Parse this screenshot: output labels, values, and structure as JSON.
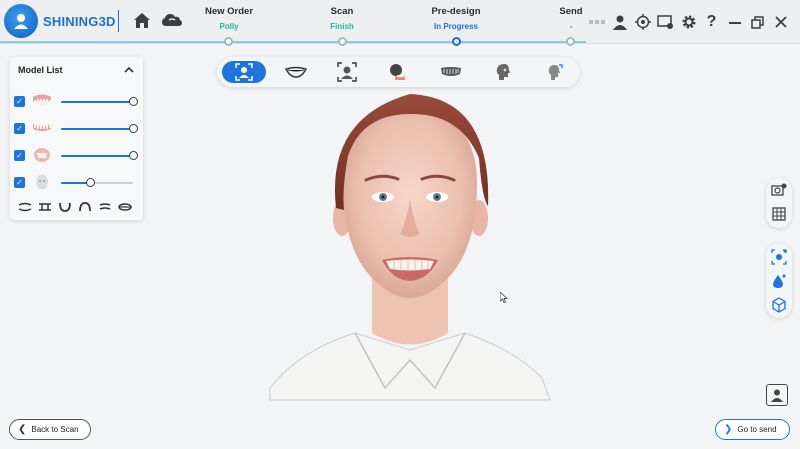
{
  "header": {
    "logo_text": "SHINING3D",
    "steps": [
      {
        "name": "New Order",
        "status": "Polly",
        "state": "done"
      },
      {
        "name": "Scan",
        "status": "Finish",
        "state": "done"
      },
      {
        "name": "Pre-design",
        "status": "In Progress",
        "state": "active"
      },
      {
        "name": "Send",
        "status": "-",
        "state": "pending"
      }
    ],
    "icons": [
      "home-icon",
      "cloud-icon",
      "more-icon",
      "user-icon",
      "target-icon",
      "screen-settings-icon",
      "gear-icon",
      "help-icon",
      "minimize-icon",
      "restore-icon",
      "close-icon"
    ]
  },
  "model_list": {
    "title": "Model List",
    "items": [
      {
        "name": "upper-jaw",
        "checked": true,
        "opacity": 1.0
      },
      {
        "name": "lower-jaw",
        "checked": true,
        "opacity": 1.0
      },
      {
        "name": "teeth-model",
        "checked": true,
        "opacity": 1.0
      },
      {
        "name": "face-scan",
        "checked": true,
        "opacity": 0.4
      }
    ],
    "tools": [
      "upper-view-icon",
      "bite-view-icon",
      "lower-arch-icon",
      "upper-arch-icon",
      "split-view-icon",
      "stack-view-icon"
    ]
  },
  "center_toolbar": {
    "tools": [
      "face-scan-icon",
      "smile-icon",
      "face-align-icon",
      "face-overlay-icon",
      "teeth-design-icon",
      "head-profile-icon",
      "head-rotate-icon"
    ],
    "active_index": 0
  },
  "right_tools": {
    "group1": [
      "camera-settings-icon",
      "grid-view-icon"
    ],
    "group2": [
      "landmark-icon",
      "color-drop-icon",
      "cube-view-icon"
    ]
  },
  "footer": {
    "back_label": "Back to Scan",
    "send_label": "Go to send"
  },
  "colors": {
    "accent": "#1d74d9",
    "done": "#1fb9a7"
  }
}
